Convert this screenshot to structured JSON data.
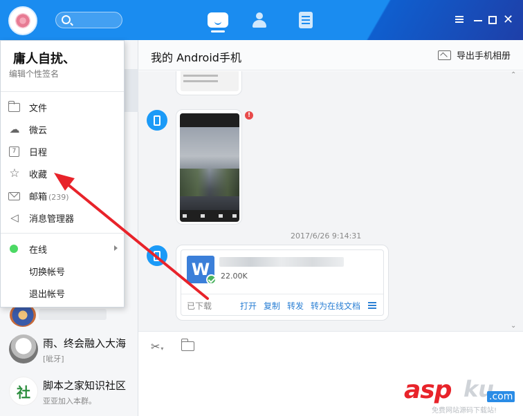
{
  "user": {
    "name": "庸人自扰、",
    "signature": "编辑个性签名"
  },
  "menu": {
    "items": [
      {
        "label": "文件",
        "icon": "folder-icon"
      },
      {
        "label": "微云",
        "icon": "cloud-icon"
      },
      {
        "label": "日程",
        "icon": "calendar-icon"
      },
      {
        "label": "收藏",
        "icon": "star-icon"
      },
      {
        "label": "邮箱",
        "icon": "mail-icon",
        "count": "(239)"
      },
      {
        "label": "消息管理器",
        "icon": "speaker-icon"
      }
    ],
    "status": {
      "label": "在线",
      "color": "#4cd964"
    },
    "switch_account": "切换帐号",
    "logout": "退出帐号"
  },
  "contacts": [
    {
      "name": "雨、终会融入大海",
      "message": "[呲牙]"
    },
    {
      "name": "脚本之家知识社区",
      "message": "亚亚加入本群。",
      "avatar_text": "社"
    }
  ],
  "chat": {
    "title": "我的 Android手机",
    "export_label": "导出手机相册",
    "timestamp": "2017/6/26 9:14:31",
    "file": {
      "icon_letter": "W",
      "size": "22.00K",
      "status": "已下载",
      "actions": {
        "open": "打开",
        "copy": "复制",
        "forward": "转发",
        "to_online": "转为在线文档"
      }
    }
  },
  "watermark": {
    "brand": "asp",
    "brand_suffix": "ku",
    "domain": ".com",
    "slogan": "免费网站源码下载站!"
  },
  "colors": {
    "titlebar": "#1a8cf0",
    "accent_link": "#2a7fd4",
    "online": "#4cd964",
    "annotation": "#e8232a"
  }
}
